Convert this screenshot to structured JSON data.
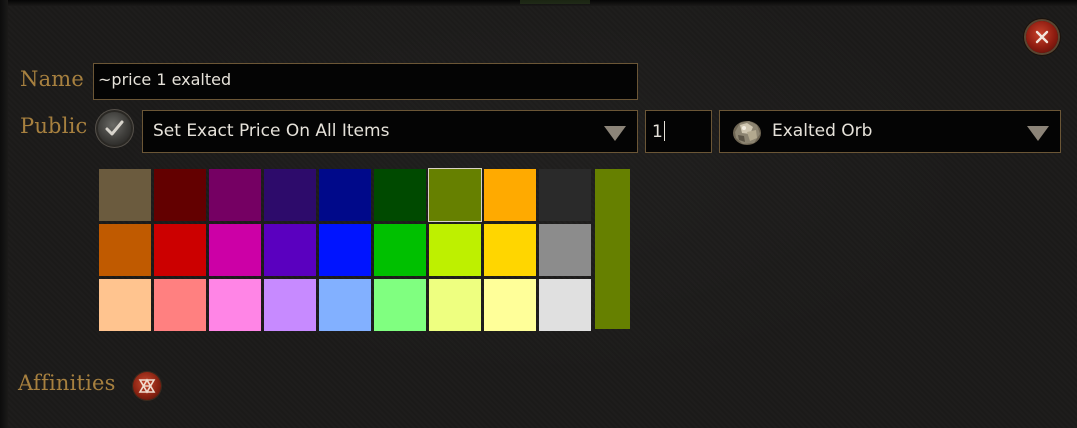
{
  "dialog": {
    "name_label": "Name",
    "name_value": "~price 1 exalted",
    "public_label": "Public",
    "public_checked": true,
    "price_mode_selected": "Set Exact Price On All Items",
    "quantity_value": "1",
    "currency_selected": "Exalted Orb",
    "affinities_label": "Affinities"
  },
  "color_grid": {
    "rows": [
      [
        "#6b5b3e",
        "#630000",
        "#750063",
        "#2d0b6b",
        "#00098a",
        "#004a00",
        "#668000",
        "#ffaa00",
        "#2a2a2a"
      ],
      [
        "#c05a00",
        "#cc0000",
        "#cc00a6",
        "#5a00bf",
        "#0014ff",
        "#00c000",
        "#bef000",
        "#ffd600",
        "#8c8c8c"
      ],
      [
        "#ffc48f",
        "#ff8080",
        "#ff85e6",
        "#c78aff",
        "#82b0ff",
        "#80ff80",
        "#eeff80",
        "#ffff99",
        "#e0e0e0"
      ]
    ],
    "selected_color": "#668000"
  },
  "icons": {
    "close": "close-icon",
    "public_toggle": "checkmark-icon",
    "dropdown": "triangle-down-icon",
    "currency": "exalted-orb-icon",
    "affinities": "affinity-symbol-icon"
  },
  "colors": {
    "label": "#a7803f",
    "field_border": "#6b5636",
    "field_bg": "#040404",
    "text": "#e6e2da"
  }
}
